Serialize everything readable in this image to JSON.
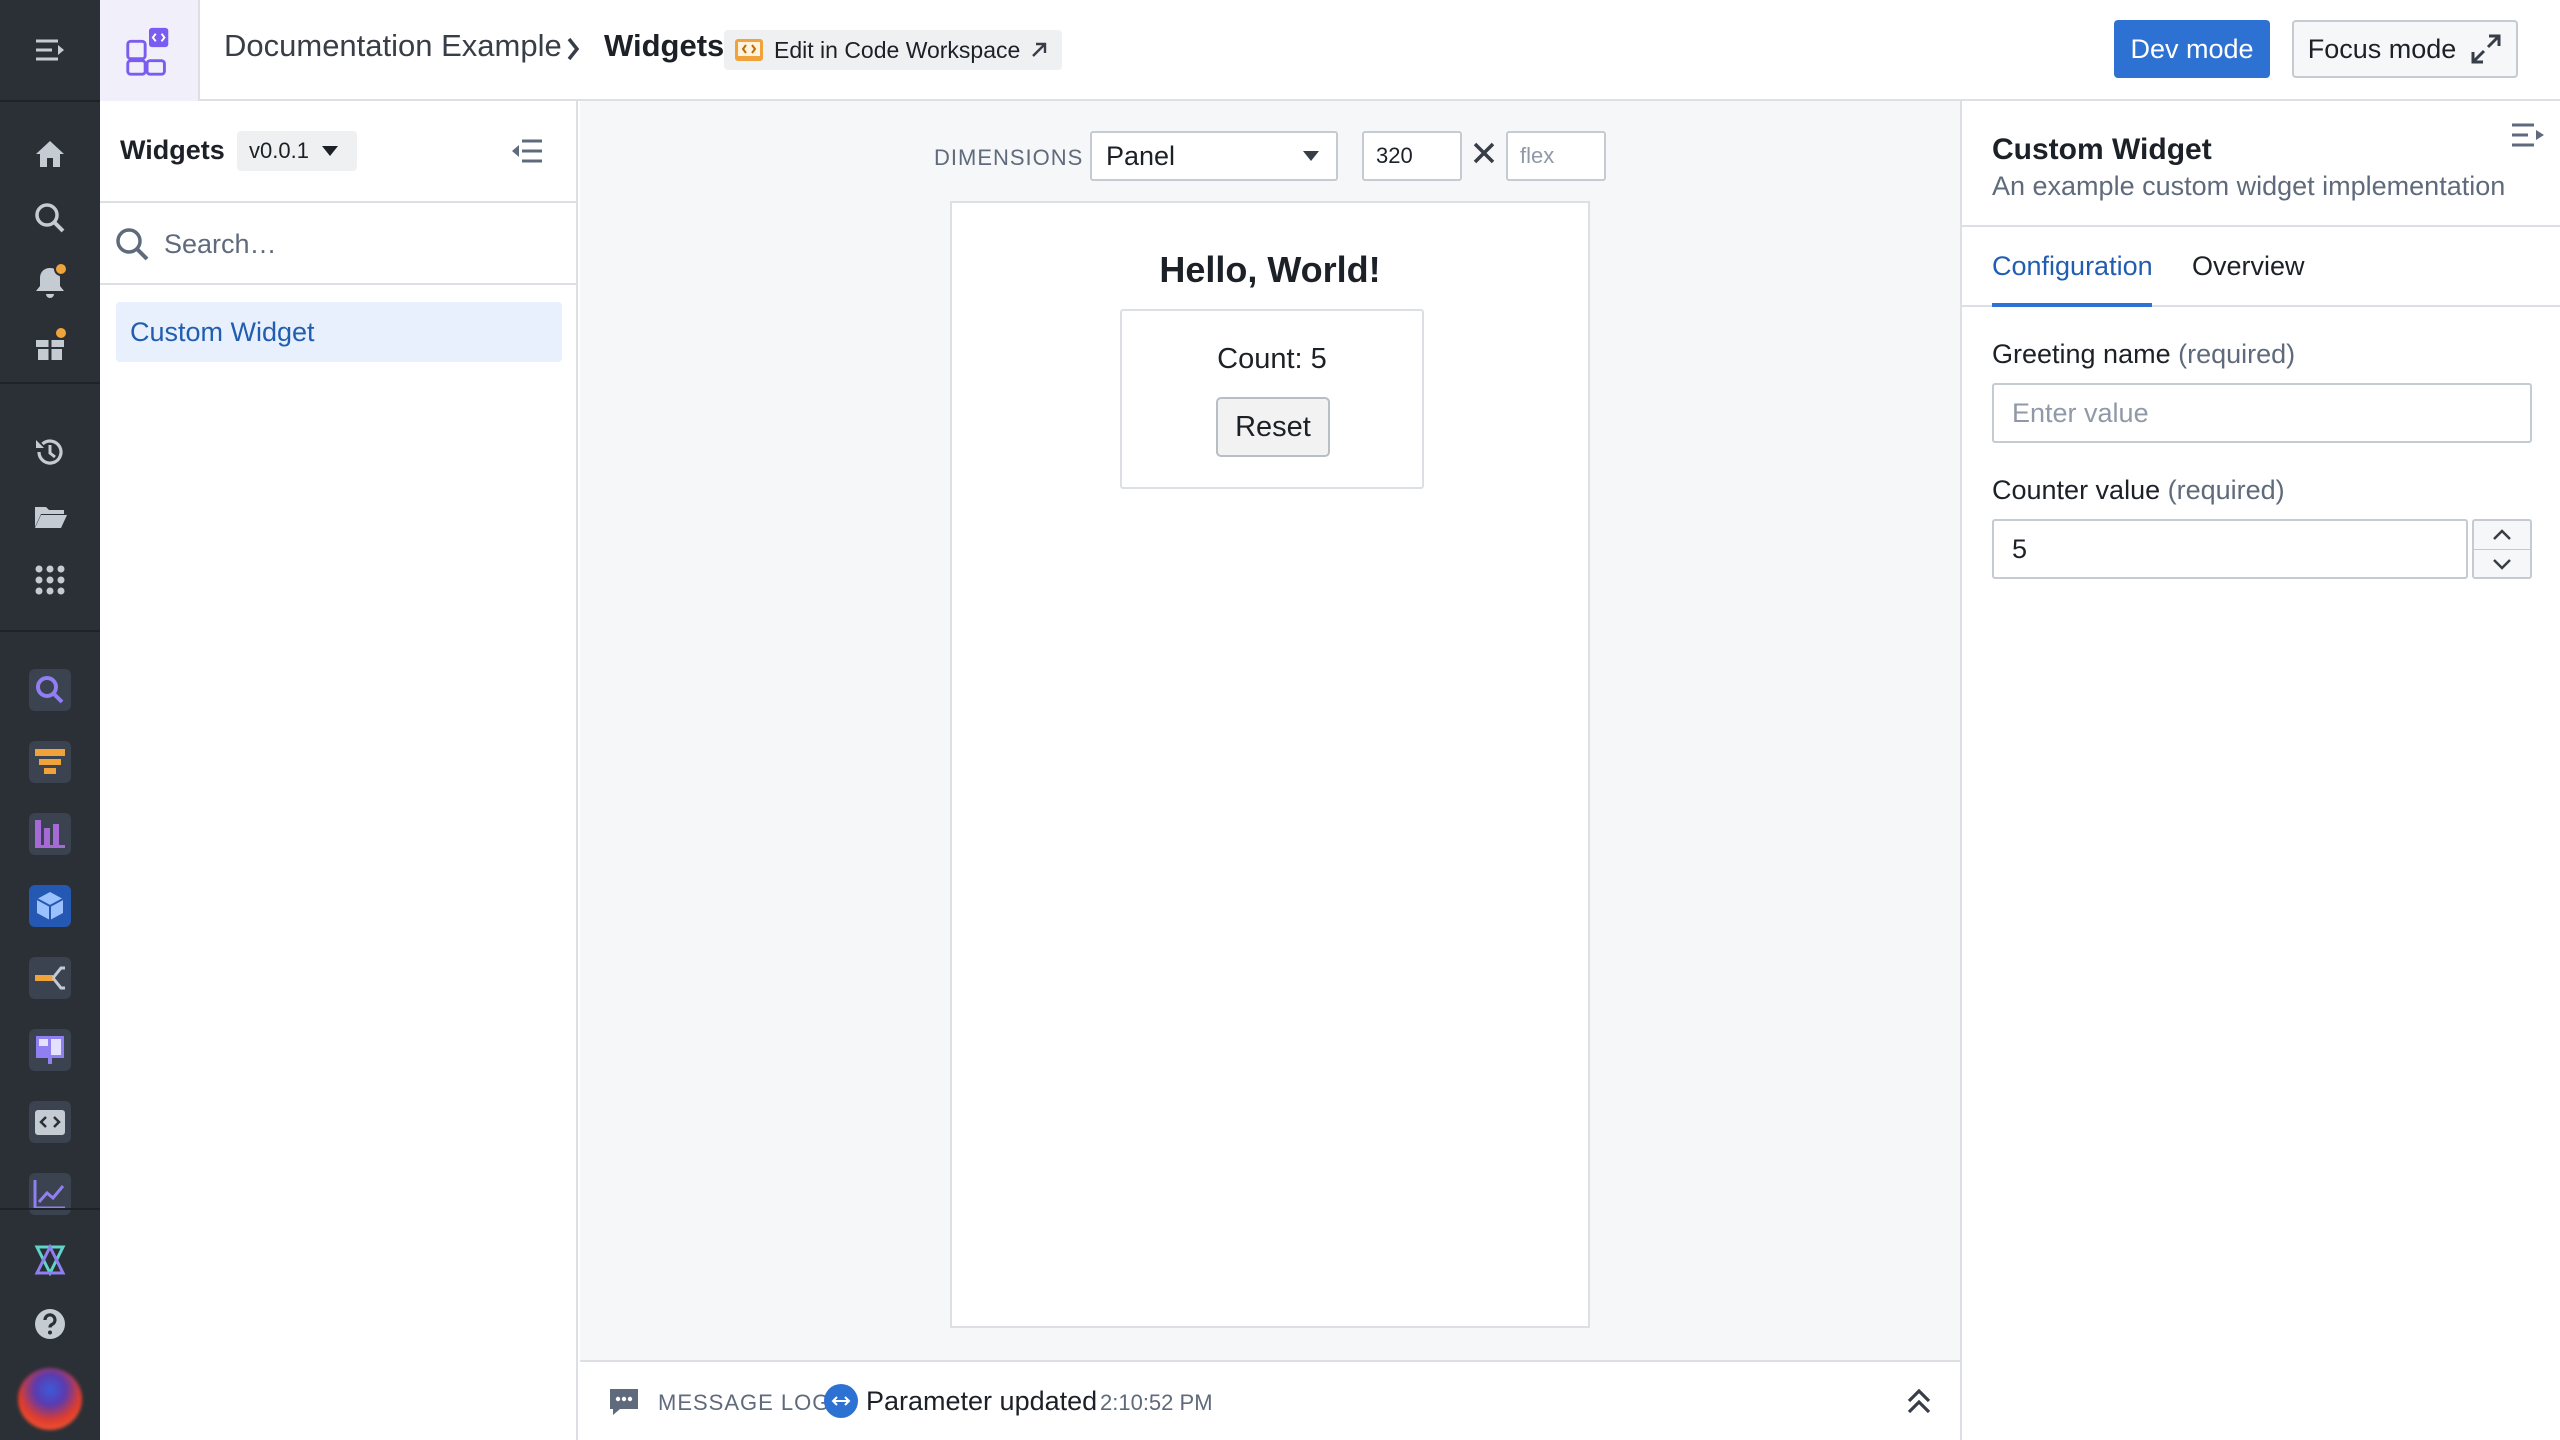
{
  "header": {
    "breadcrumb_project": "Documentation Example",
    "breadcrumb_page": "Widgets",
    "edit_link_label": "Edit in Code Workspace",
    "dev_mode_label": "Dev mode",
    "focus_mode_label": "Focus mode",
    "accent": "#2d72d2"
  },
  "rail": {
    "icons": [
      "menu-icon",
      "home-icon",
      "search-icon",
      "notifications-icon",
      "gift-icon",
      "history-icon",
      "folder-icon",
      "apps-grid-icon"
    ],
    "apps": [
      "search-app-icon",
      "pipeline-app-icon",
      "chart-app-icon",
      "object-app-icon",
      "lineage-app-icon",
      "workshop-app-icon",
      "code-app-icon",
      "analytics-app-icon",
      "ontology-app-icon"
    ],
    "help_icon": "help-icon"
  },
  "left_panel": {
    "title": "Widgets",
    "version": "v0.0.1",
    "search_placeholder": "Search…",
    "items": [
      {
        "label": "Custom Widget",
        "selected": true
      }
    ]
  },
  "canvas": {
    "dimensions_label": "DIMENSIONS",
    "layout_select": "Panel",
    "width_value": "320",
    "height_placeholder": "flex",
    "preview": {
      "heading": "Hello, World!",
      "count_text": "Count: 5",
      "reset_label": "Reset"
    }
  },
  "message_log": {
    "label": "MESSAGE LOG",
    "last_message": "Parameter updated",
    "timestamp": "2:10:52 PM"
  },
  "right_panel": {
    "title": "Custom Widget",
    "subtitle": "An example custom widget implementation",
    "tabs": [
      {
        "label": "Configuration",
        "active": true
      },
      {
        "label": "Overview",
        "active": false
      }
    ],
    "fields": [
      {
        "label": "Greeting name",
        "required_text": "(required)",
        "value": "",
        "placeholder": "Enter value"
      },
      {
        "label": "Counter value",
        "required_text": "(required)",
        "value": "5"
      }
    ]
  }
}
